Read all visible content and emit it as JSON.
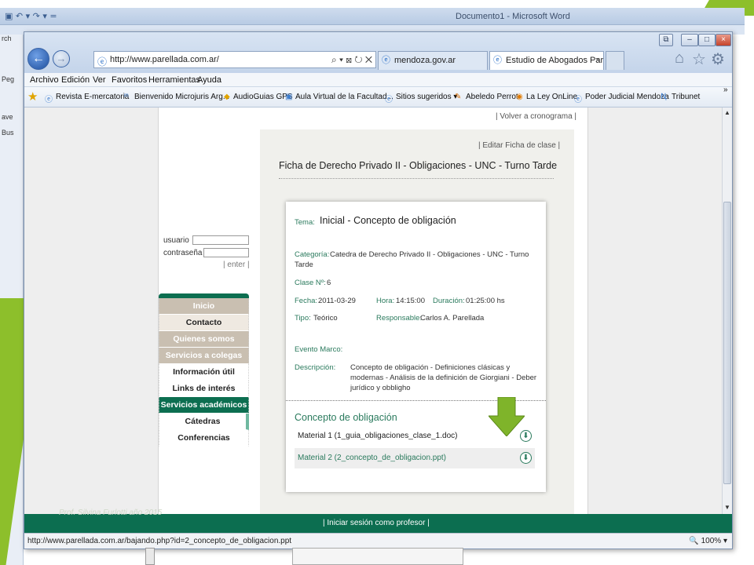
{
  "word": {
    "title": "Documento1 - Microsoft Word",
    "left_labels": [
      "rch",
      "Peg",
      "ave",
      "Bus"
    ]
  },
  "browser": {
    "address": "http://www.parellada.com.ar/",
    "tabs": [
      {
        "label": "mendoza.gov.ar"
      },
      {
        "label": "Estudio de Abogados Parell...",
        "close": "×"
      }
    ],
    "menu": [
      "Archivo",
      "Edición",
      "Ver",
      "Favoritos",
      "Herramientas",
      "Ayuda"
    ],
    "favorites": [
      "Revista E-mercatoria",
      "Bienvenido Microjuris Arg...",
      "AudioGuias GPS",
      "Aula Virtual de la Facultad...",
      "Sitios sugeridos ▾",
      "Abeledo Perrot",
      "La Ley OnLine",
      "Poder Judicial Mendoza",
      "Tribunet"
    ],
    "more": "»"
  },
  "page": {
    "volver": "| Volver a cronograma |",
    "editar": "| Editar Ficha de clase |",
    "ficha_title": "Ficha de Derecho Privado II - Obligaciones - UNC - Turno Tarde",
    "login": {
      "usuario": "usuario",
      "contrasena": "contraseña",
      "enter": "| enter |"
    },
    "menu": [
      {
        "label": "Inicio",
        "style": "tan"
      },
      {
        "label": "Contacto",
        "style": "light"
      },
      {
        "label": "Quienes somos",
        "style": "tan"
      },
      {
        "label": "Servicios a colegas",
        "style": "tan"
      },
      {
        "label": "Información útil",
        "style": "white"
      },
      {
        "label": "Links de interés",
        "style": "white"
      },
      {
        "label": "Servicios académicos",
        "style": "green"
      },
      {
        "label": "Cátedras",
        "style": "white"
      },
      {
        "label": "Conferencias",
        "style": "white"
      }
    ],
    "card": {
      "tema_label": "Tema:",
      "tema_value": "Inicial - Concepto de obligación",
      "categoria_label": "Categoría:",
      "categoria_value1": "Catedra de Derecho Privado II - Obligaciones - UNC - Turno",
      "categoria_value2": "Tarde",
      "clase_label": "Clase Nº:",
      "clase_value": "6",
      "fecha_label": "Fecha:",
      "fecha_value": "2011-03-29",
      "hora_label": "Hora:",
      "hora_value": "14:15:00",
      "duracion_label": "Duración:",
      "duracion_value": "01:25:00 hs",
      "tipo_label": "Tipo:",
      "tipo_value": "Teórico",
      "responsable_label": "Responsable:",
      "responsable_value": "Carlos A. Parellada",
      "evento_label": "Evento Marco:",
      "descripcion_label": "Descripción:",
      "descripcion_lines": [
        "Concepto de obligación - Definiciones clásicas y",
        "modernas - Análisis de la definición de Giorgiani - Deber",
        "jurídico y obbligho"
      ],
      "section_heading": "Concepto de obligación",
      "materials": [
        "Material 1 (1_guia_obligaciones_clase_1.doc)",
        "Material 2 (2_concepto_de_obligacion.ppt)"
      ]
    },
    "footer_link": "|     Iniciar sesión como profesor     |"
  },
  "status": {
    "url": "http://www.parellada.com.ar/bajando.php?id=2_concepto_de_obligacion.ppt",
    "zoom": "100%"
  },
  "watermark": "Prof. Silvina Furlotti año 2015",
  "colors": {
    "accent_green": "#0c6e50",
    "slide_green": "#8dbf2b",
    "label_green": "#2a7a5d"
  }
}
